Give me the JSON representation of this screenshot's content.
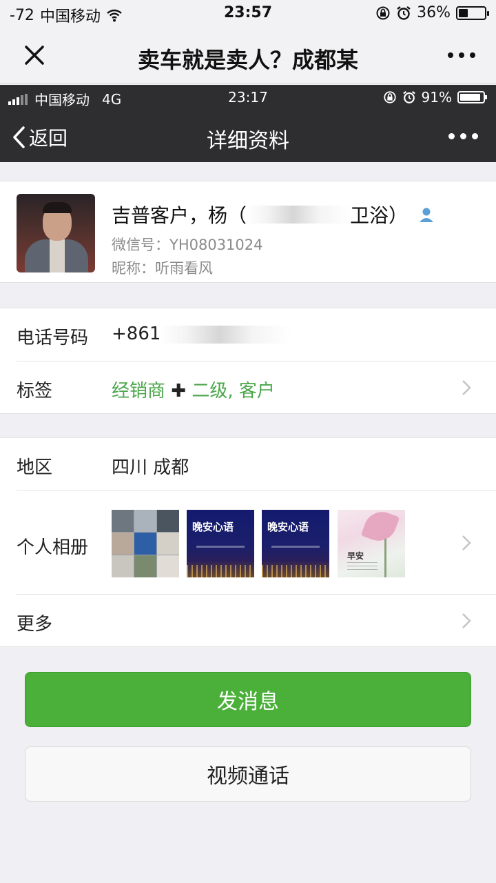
{
  "outer_status": {
    "signal_text": "-72",
    "carrier": "中国移动",
    "time": "23:57",
    "battery_percent": "36%",
    "battery_level": 0.36
  },
  "outer_header": {
    "title": "卖车就是卖人？成都某"
  },
  "inner_status": {
    "carrier": "中国移动",
    "network": "4G",
    "time": "23:17",
    "battery_percent": "91%",
    "battery_level": 0.91
  },
  "inner_nav": {
    "back_label": "返回",
    "title": "详细资料"
  },
  "profile": {
    "name_prefix": "吉普客户，杨（",
    "name_suffix": "卫浴）",
    "wechat_id": "微信号：YH08031024",
    "nickname": "昵称：听雨看风"
  },
  "contact": {
    "phone_label": "电话号码",
    "phone_value": "+861",
    "tags_label": "标签",
    "tags_part1": "经销商",
    "tags_plus": "✚",
    "tags_part2": "二级, 客户"
  },
  "details": {
    "region_label": "地区",
    "region_value": "四川 成都",
    "album_label": "个人相册",
    "album_thumbs": [
      {
        "type": "collage"
      },
      {
        "type": "night",
        "text": "晚安心语"
      },
      {
        "type": "night",
        "text": "晚安心语"
      },
      {
        "type": "lotus",
        "text": "早安"
      }
    ],
    "more_label": "更多"
  },
  "buttons": {
    "message": "发消息",
    "video_call": "视频通话"
  },
  "colors": {
    "accent_green": "#4bb03a",
    "tag_green": "#4aa64a",
    "nav_dark": "#2e2e31"
  }
}
